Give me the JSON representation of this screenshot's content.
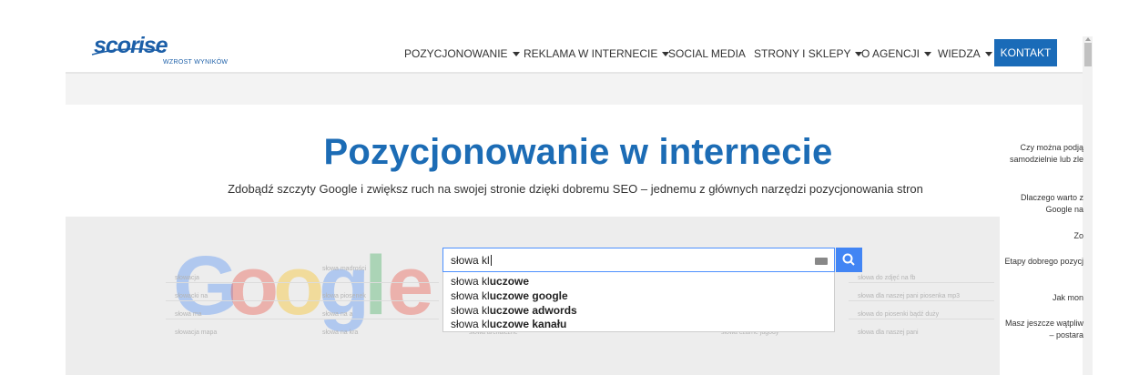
{
  "brand": {
    "logo_word": "scorise",
    "tagline": "WZROST WYNIKÓW"
  },
  "nav": {
    "items": [
      {
        "label": "POZYCJONOWANIE",
        "dropdown": true
      },
      {
        "label": "REKLAMA W INTERNECIE",
        "dropdown": true
      },
      {
        "label": "SOCIAL MEDIA",
        "dropdown": false
      },
      {
        "label": "STRONY I SKLEPY",
        "dropdown": true
      },
      {
        "label": "O AGENCJI",
        "dropdown": true
      },
      {
        "label": "WIEDZA",
        "dropdown": true
      }
    ],
    "contact_label": "KONTAKT"
  },
  "hero": {
    "title": "Pozycjonowanie w internecie",
    "subtitle": "Zdobądź szczyty Google i zwiększ ruch na swojej stronie dzięki dobremu SEO – jednemu z głównych narzędzi pozycjonowania stron"
  },
  "side_panel": [
    "Czy można podją",
    "samodzielnie lub zle",
    "Dlaczego warto z",
    "Google na",
    "Zo",
    "Etapy dobrego pozycj",
    "Jak mon",
    "Masz jeszcze wątpliw",
    "– postara"
  ],
  "search_image": {
    "query": "słowa kl",
    "suggestions": [
      {
        "prefix": "słowa kl",
        "rest": "uczowe"
      },
      {
        "prefix": "słowa kl",
        "rest": "uczowe google"
      },
      {
        "prefix": "słowa kl",
        "rest": "uczowe adwords"
      },
      {
        "prefix": "słowa kl",
        "rest": "uczowe kanału"
      }
    ],
    "bg_words_left": [
      "słowacja",
      "słowacki na",
      "słowa ma",
      "słowacja mapa"
    ],
    "bg_words_mid": [
      "słowa madrości",
      "słowa piosenek",
      "słowa na a",
      "słowa na kra"
    ],
    "bg_words_right": [
      "słowa do zdjęć na fb",
      "słowa dla naszej pani piosenka mp3",
      "słowa do piosenki bądź duży",
      "słowa dla naszej pani"
    ],
    "bg_words_bottom": [
      "słowa archaiczne",
      "słowa czarne jagody"
    ],
    "google_letters": [
      {
        "char": "G",
        "color": "#4285f4"
      },
      {
        "char": "o",
        "color": "#ea4335"
      },
      {
        "char": "o",
        "color": "#fbbc05"
      },
      {
        "char": "g",
        "color": "#4285f4"
      },
      {
        "char": "l",
        "color": "#34a853"
      },
      {
        "char": "e",
        "color": "#ea4335"
      }
    ]
  }
}
